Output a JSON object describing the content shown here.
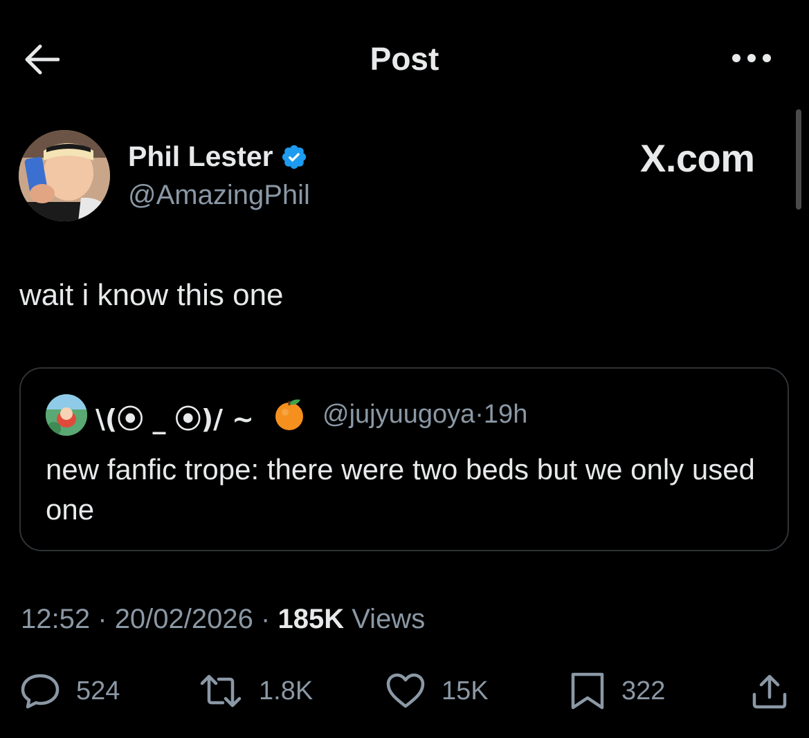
{
  "header": {
    "title": "Post"
  },
  "author": {
    "name": "Phil Lester",
    "handle": "@AmazingPhil",
    "verified": true
  },
  "watermark": "X.com",
  "tweet": {
    "text": "wait i know this one"
  },
  "quote": {
    "name": "\\(⦿ _ ⦿)/ ~",
    "emoji": "orange-emoji",
    "handle": "@jujyuugoya",
    "separator": "·",
    "age": "19h",
    "text": "new fanfic trope: there were two beds but we only used one"
  },
  "meta": {
    "time": "12:52",
    "sep1": "·",
    "date": "20/02/2026",
    "sep2": "·",
    "views_count": "185K",
    "views_label": "Views"
  },
  "actions": {
    "replies": "524",
    "reposts": "1.8K",
    "likes": "15K",
    "bookmarks": "322"
  },
  "colors": {
    "background": "#000000",
    "text": "#e7e9ea",
    "muted": "#8b98a5",
    "verified": "#1d9bf0",
    "border": "#2f3336"
  },
  "icons": [
    "back-arrow-icon",
    "more-icon",
    "verified-badge-icon",
    "reply-icon",
    "repost-icon",
    "like-icon",
    "bookmark-icon",
    "share-icon"
  ]
}
